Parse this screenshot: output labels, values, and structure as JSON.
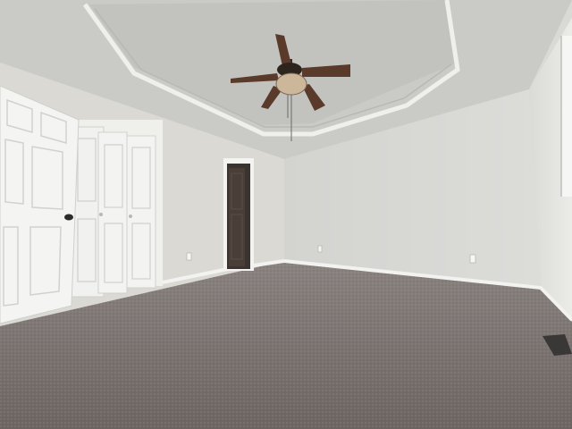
{
  "scene": {
    "description_free": true,
    "colors": {
      "ceiling": "#cfcfcc",
      "tray_ceiling": "#c6c6c4",
      "wall_left": "#dedcd6",
      "wall_back": "#d7d7d4",
      "wall_right": "#e2e2df",
      "carpet": "#7b7471",
      "trim": "#f4f4f2",
      "door": "#f2f2f0",
      "door_dark": "#3b332e",
      "fan_wood": "#5a3a2a",
      "fan_globe": "#cdb79b",
      "vent": "#3a3836"
    },
    "icons": [
      "ceiling-fan-icon",
      "door-knob-icon",
      "outlet-icon",
      "floor-vent-icon"
    ]
  }
}
